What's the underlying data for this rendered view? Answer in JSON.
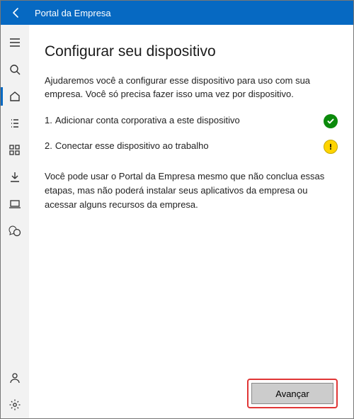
{
  "titlebar": {
    "back_label": "Voltar",
    "title": "Portal da Empresa"
  },
  "sidebar": {
    "items": [
      {
        "name": "hamburger-icon",
        "label": "Menu"
      },
      {
        "name": "search-icon",
        "label": "Pesquisa"
      },
      {
        "name": "home-icon",
        "label": "Início"
      },
      {
        "name": "list-icon",
        "label": "Aplicativos"
      },
      {
        "name": "grid-icon",
        "label": "Categorias"
      },
      {
        "name": "download-icon",
        "label": "Downloads"
      },
      {
        "name": "laptop-icon",
        "label": "Dispositivos"
      },
      {
        "name": "chat-icon",
        "label": "Suporte"
      }
    ],
    "bottom": [
      {
        "name": "person-icon",
        "label": "Conta"
      },
      {
        "name": "gear-icon",
        "label": "Configurações"
      }
    ]
  },
  "page": {
    "heading": "Configurar seu dispositivo",
    "intro": "Ajudaremos você a configurar esse dispositivo para uso com sua empresa. Você só precisa fazer isso uma vez por dispositivo.",
    "steps": [
      {
        "num": "1.",
        "text": "Adicionar conta corporativa a este dispositivo",
        "status": "success"
      },
      {
        "num": "2.",
        "text": "Conectar esse dispositivo ao trabalho",
        "status": "warn"
      }
    ],
    "note": "Você pode usar o Portal da Empresa mesmo que não conclua essas etapas, mas não poderá instalar seus aplicativos da empresa ou acessar alguns recursos da empresa.",
    "next_label": "Avançar"
  }
}
